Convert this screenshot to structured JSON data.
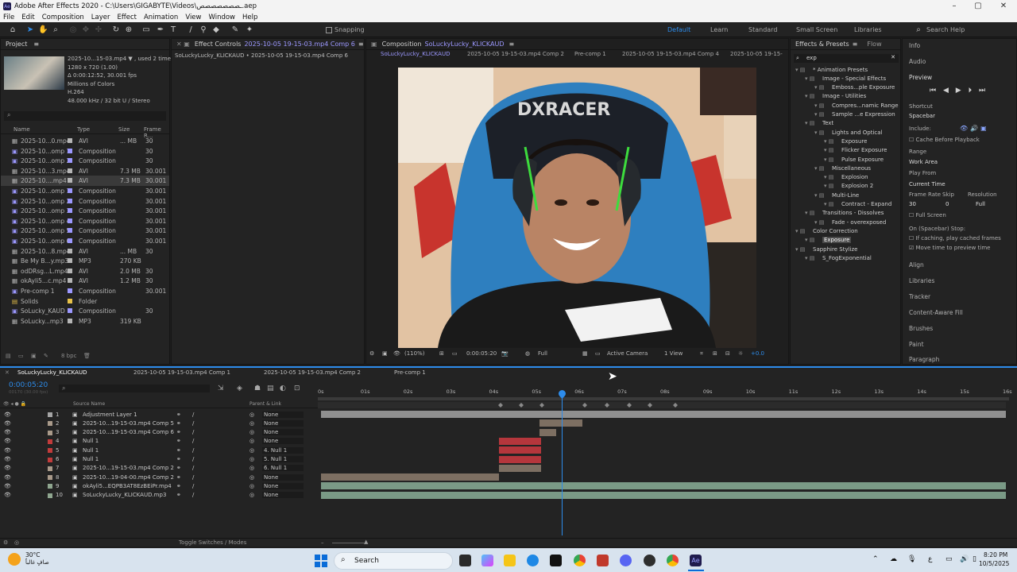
{
  "app": {
    "title": "Adobe After Effects 2020 - C:\\Users\\GIGABYTE\\Videos\\ـصصصصصصص.aep"
  },
  "menu": [
    "File",
    "Edit",
    "Composition",
    "Layer",
    "Effect",
    "Animation",
    "View",
    "Window",
    "Help"
  ],
  "toolbar": {
    "snapping": "Snapping",
    "workspaces": [
      "Default",
      "Learn",
      "Standard",
      "Small Screen",
      "Libraries"
    ],
    "search_placeholder": "Search Help"
  },
  "project": {
    "tab": "Project",
    "info_lines": [
      "2025-10...15-03.mp4 ▼ , used 2 times",
      "1280 x 720 (1.00)",
      "Δ 0:00:12:52, 30.001 fps",
      "Millions of Colors",
      "H.264",
      "48.000 kHz / 32 bit U / Stereo"
    ],
    "headers": [
      "Name",
      "Type",
      "Size",
      "Frame R..."
    ],
    "items": [
      {
        "name": "2025-10...0.mp4",
        "type": "AVI",
        "size": "... MB",
        "fr": "30",
        "color": "#b6b6b6"
      },
      {
        "name": "2025-10...omp 1",
        "type": "Composition",
        "size": "",
        "fr": "30",
        "color": "#9c98ff"
      },
      {
        "name": "2025-10...omp 2",
        "type": "Composition",
        "size": "",
        "fr": "30",
        "color": "#9c98ff"
      },
      {
        "name": "2025-10...3.mp4",
        "type": "AVI",
        "size": "7.3 MB",
        "fr": "30.001",
        "color": "#b6b6b6"
      },
      {
        "name": "2025-10....mp4",
        "type": "AVI",
        "size": "7.3 MB",
        "fr": "30.001",
        "color": "#b6b6b6"
      },
      {
        "name": "2025-10...omp 1",
        "type": "Composition",
        "size": "",
        "fr": "30.001",
        "color": "#9c98ff"
      },
      {
        "name": "2025-10...omp 2",
        "type": "Composition",
        "size": "",
        "fr": "30.001",
        "color": "#9c98ff"
      },
      {
        "name": "2025-10...omp 3",
        "type": "Composition",
        "size": "",
        "fr": "30.001",
        "color": "#9c98ff"
      },
      {
        "name": "2025-10...omp 4",
        "type": "Composition",
        "size": "",
        "fr": "30.001",
        "color": "#9c98ff"
      },
      {
        "name": "2025-10...omp 5",
        "type": "Composition",
        "size": "",
        "fr": "30.001",
        "color": "#9c98ff"
      },
      {
        "name": "2025-10...omp 6",
        "type": "Composition",
        "size": "",
        "fr": "30.001",
        "color": "#9c98ff"
      },
      {
        "name": "2025-10...8.mp4",
        "type": "AVI",
        "size": "... MB",
        "fr": "30",
        "color": "#b6b6b6"
      },
      {
        "name": "Be My B...y.mp3",
        "type": "MP3",
        "size": "270 KB",
        "fr": "",
        "color": "#b6b6b6"
      },
      {
        "name": "odDRsg...L.mp4",
        "type": "AVI",
        "size": "2.0 MB",
        "fr": "30",
        "color": "#b6b6b6"
      },
      {
        "name": "okAyli5...c.mp4",
        "type": "AVI",
        "size": "1.2 MB",
        "fr": "30",
        "color": "#b6b6b6"
      },
      {
        "name": "Pre-comp 1",
        "type": "Composition",
        "size": "",
        "fr": "30.001",
        "color": "#9c98ff"
      },
      {
        "name": "Solids",
        "type": "Folder",
        "size": "",
        "fr": "",
        "color": "#e8c24a"
      },
      {
        "name": "SoLucky_KAUD",
        "type": "Composition",
        "size": "",
        "fr": "30",
        "color": "#9c98ff"
      },
      {
        "name": "SoLucky...mp3",
        "type": "MP3",
        "size": "319 KB",
        "fr": "",
        "color": "#b6b6b6"
      }
    ],
    "bpc": "8 bpc"
  },
  "effect_controls": {
    "tab": "Effect Controls",
    "tab_file": "2025-10-05 19-15-03.mp4 Comp 6",
    "sub": "SoLuckyLucky_KLICKAUD • 2025-10-05 19-15-03.mp4 Comp 6"
  },
  "composition": {
    "tab": "Composition",
    "tab_name": "SoLuckyLucky_KLICKAUD",
    "breadcrumbs": [
      "SoLuckyLucky_KLICKAUD",
      "2025-10-05 19-15-03.mp4 Comp 2",
      "Pre-comp 1",
      "2025-10-05 19-15-03.mp4 Comp 4",
      "2025-10-05 19-15-"
    ],
    "zoom": "(110%)",
    "timecode": "0:00:05:20",
    "resolution": "Full",
    "camera": "Active Camera",
    "views": "1 View",
    "exposure": "+0.0"
  },
  "effects_presets": {
    "tab": "Effects & Presets",
    "flow_tab": "Flow",
    "search_value": "exp",
    "tree": [
      {
        "label": "* Animation Presets",
        "indent": 0,
        "color": "#cfcfcf"
      },
      {
        "label": "Image - Special Effects",
        "indent": 1,
        "color": "#cfcfcf"
      },
      {
        "label": "Emboss...ple Exposure",
        "indent": 2,
        "color": "#cfcfcf"
      },
      {
        "label": "Image - Utilities",
        "indent": 1,
        "color": "#cfcfcf"
      },
      {
        "label": "Compres...namic Range",
        "indent": 2,
        "color": "#cfcfcf"
      },
      {
        "label": "Sample ...e Expression",
        "indent": 2,
        "color": "#cfcfcf"
      },
      {
        "label": "Text",
        "indent": 1,
        "color": "#cfcfcf"
      },
      {
        "label": "Lights and Optical",
        "indent": 2,
        "color": "#cfcfcf"
      },
      {
        "label": "Exposure",
        "indent": 3,
        "color": "#cfcfcf"
      },
      {
        "label": "Flicker Exposure",
        "indent": 3,
        "color": "#cfcfcf"
      },
      {
        "label": "Pulse Exposure",
        "indent": 3,
        "color": "#cfcfcf"
      },
      {
        "label": "Miscellaneous",
        "indent": 2,
        "color": "#cfcfcf"
      },
      {
        "label": "Explosion",
        "indent": 3,
        "color": "#cfcfcf"
      },
      {
        "label": "Explosion 2",
        "indent": 3,
        "color": "#cfcfcf"
      },
      {
        "label": "Multi-Line",
        "indent": 2,
        "color": "#cfcfcf"
      },
      {
        "label": "Contract - Expand",
        "indent": 3,
        "color": "#cfcfcf"
      },
      {
        "label": "Transitions - Dissolves",
        "indent": 1,
        "color": "#cfcfcf"
      },
      {
        "label": "Fade - overexposed",
        "indent": 2,
        "color": "#cfcfcf"
      },
      {
        "label": "Color Correction",
        "indent": 0,
        "color": "#cfcfcf"
      },
      {
        "label": "Exposure",
        "indent": 1,
        "color": "#ffffff",
        "selected": true
      },
      {
        "label": "Sapphire Stylize",
        "indent": 0,
        "color": "#cfcfcf"
      },
      {
        "label": "S_FogExponential",
        "indent": 1,
        "color": "#cfcfcf"
      }
    ]
  },
  "right_panel": {
    "info": "Info",
    "audio": "Audio",
    "preview": "Preview",
    "shortcut_label": "Shortcut",
    "shortcut_value": "Spacebar",
    "include_label": "Include:",
    "cache_before": "Cache Before Playback",
    "range_label": "Range",
    "range_value": "Work Area",
    "play_from_label": "Play From",
    "play_from_value": "Current Time",
    "frame_rate_label": "Frame Rate",
    "skip_label": "Skip",
    "resolution_label": "Resolution",
    "frame_rate_value": "30",
    "skip_value": "0",
    "resolution_value": "Full",
    "full_screen": "Full Screen",
    "on_stop": "On (Spacebar) Stop:",
    "if_caching": "If caching, play cached frames",
    "move_time": "Move time to preview time",
    "panels": [
      "Align",
      "Libraries",
      "Tracker",
      "Content-Aware Fill",
      "Brushes",
      "Paint",
      "Paragraph"
    ]
  },
  "timeline": {
    "tabs": [
      "SoLuckyLucky_KLICKAUD",
      "2025-10-05 19-15-03.mp4 Comp 1",
      "2025-10-05 19-15-03.mp4 Comp 2",
      "Pre-comp 1"
    ],
    "timecode": "0:00:05:20",
    "timecode_sub": "00170 (30.00 fps)",
    "col_source": "Source Name",
    "col_parent": "Parent & Link",
    "ruler": [
      "0s",
      "01s",
      "02s",
      "03s",
      "04s",
      "05s",
      "06s",
      "07s",
      "08s",
      "09s",
      "10s",
      "11s",
      "12s",
      "13s",
      "14s",
      "15s",
      "16s"
    ],
    "layers": [
      {
        "num": "1",
        "name": "Adjustment Layer 1",
        "parent": "None",
        "color": "#a5a5a5"
      },
      {
        "num": "2",
        "name": "2025-10...19-15-03.mp4 Comp 5",
        "parent": "None",
        "color": "#a99a8a"
      },
      {
        "num": "3",
        "name": "2025-10...19-15-03.mp4 Comp 6",
        "parent": "None",
        "color": "#a99a8a"
      },
      {
        "num": "4",
        "name": "Null 1",
        "parent": "None",
        "color": "#c23b3b"
      },
      {
        "num": "5",
        "name": "Null 1",
        "parent": "4. Null 1",
        "color": "#c23b3b"
      },
      {
        "num": "6",
        "name": "Null 1",
        "parent": "5. Null 1",
        "color": "#c23b3b"
      },
      {
        "num": "7",
        "name": "2025-10...19-15-03.mp4 Comp 2",
        "parent": "6. Null 1",
        "color": "#a99a8a"
      },
      {
        "num": "8",
        "name": "2025-10...19-04-00.mp4 Comp 2",
        "parent": "None",
        "color": "#a99a8a"
      },
      {
        "num": "9",
        "name": "okAyli5...EQPB3AT8EzBEiPr.mp4",
        "parent": "None",
        "color": "#8fa68f"
      },
      {
        "num": "10",
        "name": "SoLuckyLucky_KLICKAUD.mp3",
        "parent": "None",
        "color": "#8fa68f"
      }
    ],
    "toggle_label": "Toggle Switches / Modes"
  },
  "taskbar": {
    "weather_temp": "30°C",
    "weather_desc": "صافٍ غالباً",
    "search": "Search",
    "time": "8:20 PM",
    "date": "10/5/2025"
  }
}
